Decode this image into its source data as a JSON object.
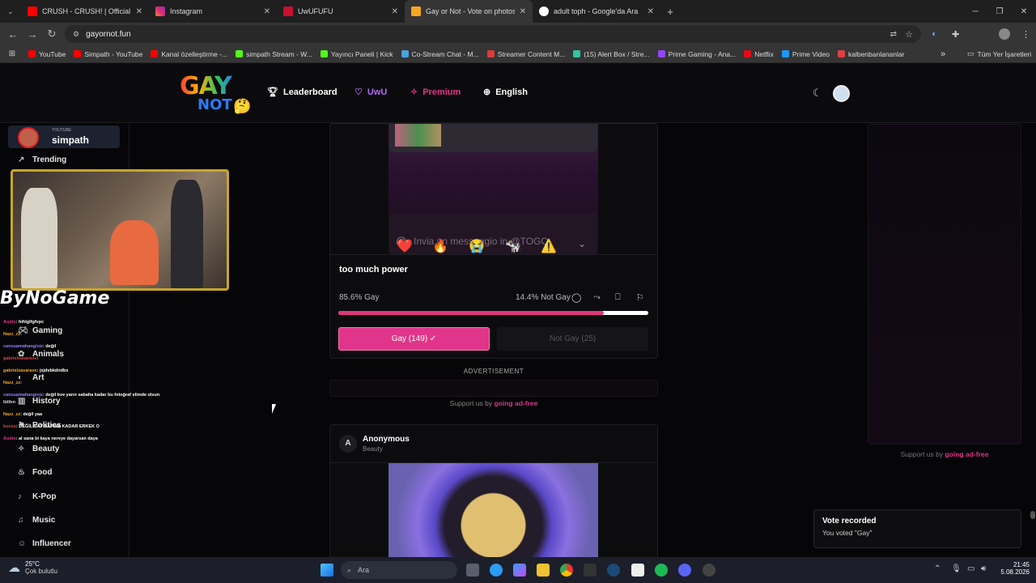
{
  "browser": {
    "tabs": [
      {
        "label": "CRUSH - CRUSH! | Official Musi",
        "color": "#ff0000",
        "active": false
      },
      {
        "label": "Instagram",
        "color": "#d6249f",
        "active": false
      },
      {
        "label": "UwUFUFU",
        "color": "#c8102e",
        "active": false
      },
      {
        "label": "Gay or Not - Vote on photos an",
        "color": "#f5a623",
        "active": true
      },
      {
        "label": "adult toph - Google'da Ara",
        "color": "#ffffff",
        "active": false
      }
    ],
    "url": "gayornot.fun",
    "bookmarks": [
      {
        "label": "YouTube",
        "color": "#ff0000"
      },
      {
        "label": "Simpath - YouTube",
        "color": "#ff0000"
      },
      {
        "label": "Kanal özelleştirme -...",
        "color": "#ff0000"
      },
      {
        "label": "simpath Stream - W...",
        "color": "#53fc18"
      },
      {
        "label": "Yayıncı Paneli | Kick",
        "color": "#53fc18"
      },
      {
        "label": "Co-Stream Chat - M...",
        "color": "#4aa3df"
      },
      {
        "label": "Streamer Content M...",
        "color": "#e03a3a"
      },
      {
        "label": "(15) Alert Box / Stre...",
        "color": "#31c3a2"
      },
      {
        "label": "Prime Gaming - Ana...",
        "color": "#9146ff"
      },
      {
        "label": "Netflix",
        "color": "#e50914"
      },
      {
        "label": "Prime Video",
        "color": "#1a98ff"
      },
      {
        "label": "kalbenbanlananlar",
        "color": "#e04040"
      }
    ],
    "bookmarks_more": "»",
    "all_bookmarks": "Tüm Yer İşaretleri"
  },
  "header": {
    "logo_top": "GAY",
    "logo_bottom": "NOT",
    "nav": [
      {
        "label": "Leaderboard",
        "icon": "trophy-icon",
        "color": "#ffffff"
      },
      {
        "label": "UwU",
        "icon": "heart-icon",
        "color": "#b06af0"
      },
      {
        "label": "Premium",
        "icon": "sparkle-icon",
        "color": "#e0358a"
      },
      {
        "label": "English",
        "icon": "globe-icon",
        "color": "#ffffff"
      }
    ]
  },
  "sidebar": {
    "overlay_platform": "YOUTUBE",
    "overlay_name": "simpath",
    "trending": "Trending",
    "categories": [
      "Gaming",
      "Animals",
      "Art",
      "History",
      "Politics",
      "Beauty",
      "Food",
      "K-Pop",
      "Music",
      "Influencer"
    ],
    "bynogame": "ByNoGame",
    "chat": [
      {
        "user": "Audio",
        "text": "hihlglfgfvpc",
        "color": "#e0358a"
      },
      {
        "user": "Nazz_zz",
        "text": "",
        "color": "#f5a623"
      },
      {
        "user": "cansuamahangisiz",
        "text": "değil",
        "color": "#9d7bff"
      },
      {
        "user": "gabrielsasarase",
        "text": "",
        "color": "#e04040"
      },
      {
        "user": "gabrielsasarase",
        "text": "jsjdvbkdndbx",
        "color": "#f5a623"
      },
      {
        "user": "Nazz_zz",
        "text": "",
        "color": "#f5a623"
      },
      {
        "user": "cansuamahangisiz",
        "text": "değil bve yarın sabaha kadar bu fotoğraf elimde olsun",
        "color": "#9d7bff"
      },
      {
        "user": "lütfen",
        "text": "",
        "color": "#dddddd"
      },
      {
        "user": "Nazz_zz",
        "text": "değil yaa",
        "color": "#f5a623"
      },
      {
        "user": "bocas",
        "text": "DEĞİL GAY SAPINA KADAR ERKEK O",
        "color": "#e04040"
      },
      {
        "user": "Audio",
        "text": "al sana bi kaya nereye dayarsan daya",
        "color": "#e0358a"
      }
    ]
  },
  "post1": {
    "dm_placeholder": "Invia un messaggio in @TOGO",
    "reactions": [
      "❤️",
      "🔥",
      "😭",
      "🐄",
      "⚠️",
      "⌄"
    ],
    "caption": "too much power",
    "gay_pct_label": "85.6% Gay",
    "notgay_pct_label": "14.4% Not Gay",
    "gay_fraction": 0.856,
    "vote_gay": "Gay (149) ✓",
    "vote_notgay": "Not Gay (25)"
  },
  "ad": {
    "label": "ADVERTISEMENT",
    "support_prefix": "Support us by",
    "support_link": "going ad-free"
  },
  "post2": {
    "avatar_letter": "A",
    "author": "Anonymous",
    "category": "Beauty"
  },
  "toast": {
    "title": "Vote recorded",
    "body": "You voted \"Gay\""
  },
  "taskbar": {
    "weather_temp": "25°C",
    "weather_desc": "Çok bulutlu",
    "search_placeholder": "Ara",
    "time": "21:45",
    "date": "5.08.2026"
  },
  "colors": {
    "accent": "#e0358a",
    "page_bg": "#060608",
    "tab_bar": "#1f1f1f"
  }
}
